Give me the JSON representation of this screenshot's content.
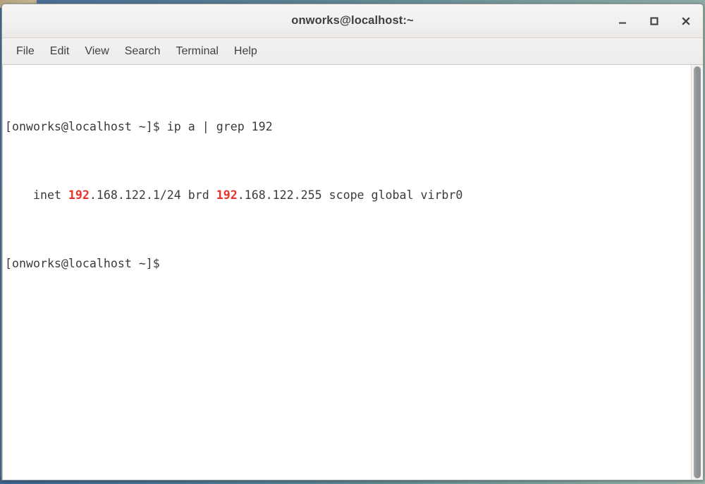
{
  "desktop": {
    "background_gradient_from": "#4a6c97",
    "background_gradient_to": "#93aea7",
    "accent_khaki": "#b2a07d"
  },
  "window": {
    "title": "onworks@localhost:~",
    "controls": [
      {
        "name": "minimize",
        "label": "_",
        "tooltip": "Minimize"
      },
      {
        "name": "maximize",
        "label": "□",
        "tooltip": "Maximize"
      },
      {
        "name": "close",
        "label": "×",
        "tooltip": "Close"
      }
    ]
  },
  "menubar": {
    "items": [
      {
        "label": "File"
      },
      {
        "label": "Edit"
      },
      {
        "label": "View"
      },
      {
        "label": "Search"
      },
      {
        "label": "Terminal"
      },
      {
        "label": "Help"
      }
    ]
  },
  "terminal": {
    "text_color": "#3b3b3b",
    "background_color": "#ffffff",
    "highlight_color": "#ed312a",
    "prompt": "[onworks@localhost ~]$",
    "command": "ip a | grep 192",
    "lines": [
      {
        "type": "prompt-command",
        "prompt": "[onworks@localhost ~]$",
        "space": " ",
        "command": "ip a | grep 192"
      },
      {
        "type": "output",
        "indent": "    ",
        "seg1": "inet ",
        "hit1": "192",
        "seg2": ".168.122.1/24 brd ",
        "hit2": "192",
        "seg3": ".168.122.255 scope global virbr0"
      },
      {
        "type": "prompt",
        "prompt": "[onworks@localhost ~]$",
        "trailing": " "
      }
    ]
  },
  "scrollbar": {
    "position": "right",
    "thumb_color": "#8f9496",
    "thumb_fills_track": "true"
  }
}
